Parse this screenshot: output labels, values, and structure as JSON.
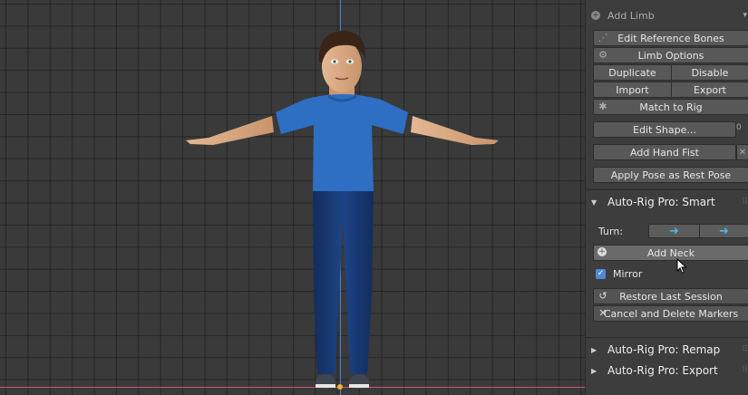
{
  "panel": {
    "add_limb": "Add Limb",
    "edit_reference_bones": "Edit Reference Bones",
    "limb_options": "Limb Options",
    "duplicate": "Duplicate",
    "disable": "Disable",
    "import": "Import",
    "export": "Export",
    "match_to_rig": "Match to Rig",
    "edit_shape": "Edit Shape...",
    "add_hand_fist": "Add Hand Fist",
    "apply_pose_as_rest_pose": "Apply Pose as Rest Pose"
  },
  "smart": {
    "title": "Auto-Rig Pro: Smart",
    "turn_label": "Turn:",
    "add_neck": "Add Neck",
    "mirror_label": "Mirror",
    "mirror_checked": true,
    "restore_last_session": "Restore Last Session",
    "cancel_and_delete_markers": "Cancel and Delete Markers"
  },
  "sections": {
    "remap": "Auto-Rig Pro: Remap",
    "export": "Auto-Rig Pro: Export"
  },
  "colors": {
    "viewport_bg": "#3a3a3a",
    "panel_bg": "#3d3d3d",
    "accent_blue": "#4d89d6",
    "y_axis": "#4a7fd0",
    "x_axis": "#d0566a",
    "shirt": "#2e6fc4",
    "jeans": "#1c3f7a"
  }
}
